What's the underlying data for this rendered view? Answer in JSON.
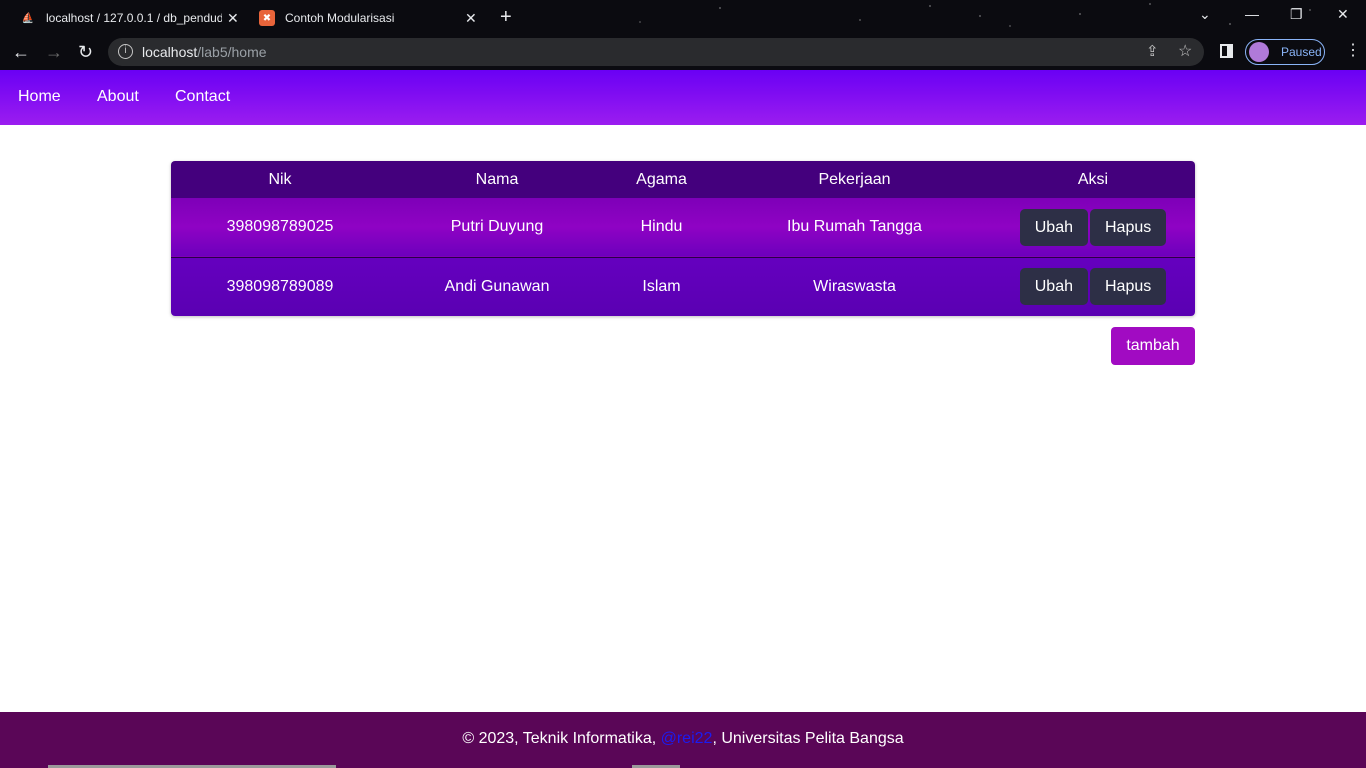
{
  "browser": {
    "tabs": [
      {
        "title": "localhost / 127.0.0.1 / db_penduduk",
        "favicon": "phpmyadmin-icon"
      },
      {
        "title": "Contoh Modularisasi",
        "favicon": "xampp-icon"
      }
    ],
    "url_host": "localhost",
    "url_path": "/lab5/home",
    "profile_label": "Paused"
  },
  "navbar": {
    "items": [
      "Home",
      "About",
      "Contact"
    ],
    "gradient": [
      "#6a00f4",
      "#9b1df0"
    ]
  },
  "table": {
    "headers": [
      "Nik",
      "Nama",
      "Agama",
      "Pekerjaan",
      "Aksi"
    ],
    "rows": [
      {
        "nik": "398098789025",
        "nama": "Putri Duyung",
        "agama": "Hindu",
        "pekerjaan": "Ibu Rumah Tangga"
      },
      {
        "nik": "398098789089",
        "nama": "Andi Gunawan",
        "agama": "Islam",
        "pekerjaan": "Wiraswasta"
      }
    ],
    "edit_label": "Ubah",
    "delete_label": "Hapus",
    "add_label": "tambah"
  },
  "footer": {
    "prefix": "© 2023, Teknik Informatika, ",
    "handle": "@rei22",
    "suffix": ", Universitas Pelita Bangsa"
  },
  "colors": {
    "header_row": "#44007d",
    "action_button": "#2d2f46",
    "add_button": "#a10bc2",
    "footer_bg": "#5a0657"
  }
}
